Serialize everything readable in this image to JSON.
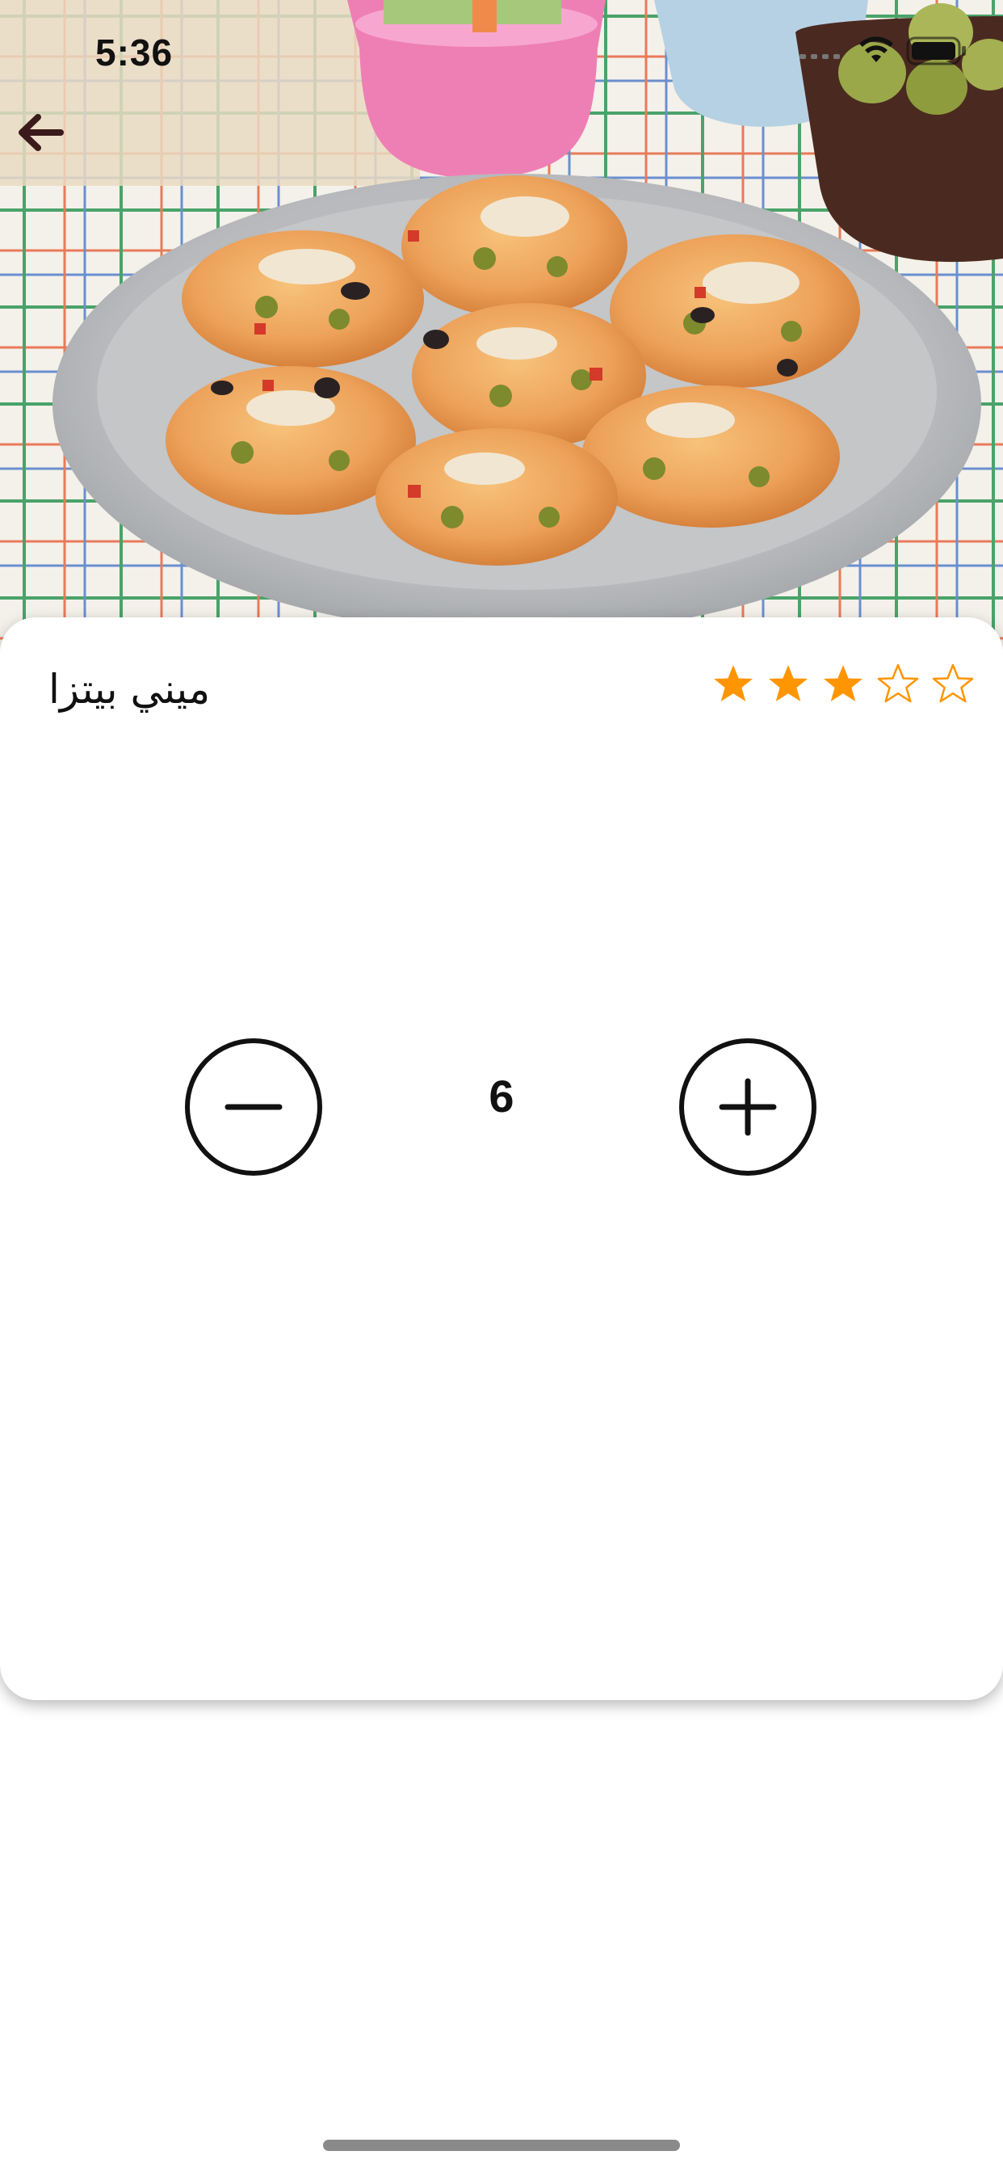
{
  "status_bar": {
    "time": "5:36"
  },
  "header": {
    "back_icon": "arrow-left-icon"
  },
  "recipe": {
    "title": "ميني بيتزا",
    "rating": 3,
    "rating_max": 5,
    "star_color": "#FF9500"
  },
  "servings_stepper": {
    "value": "6",
    "decrement_icon": "minus-circle-icon",
    "increment_icon": "plus-circle-icon"
  }
}
